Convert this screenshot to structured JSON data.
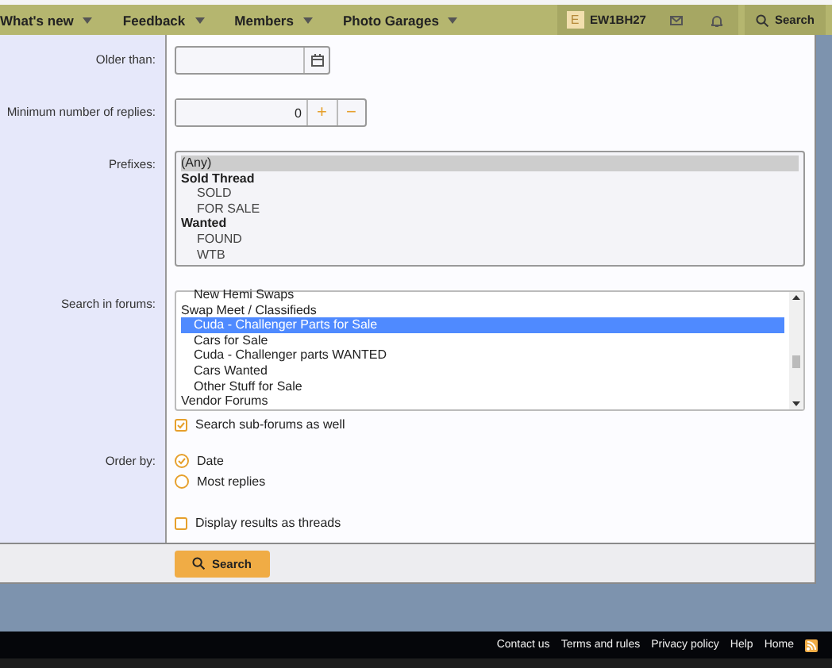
{
  "nav": {
    "items": [
      {
        "label": "What's new"
      },
      {
        "label": "Feedback"
      },
      {
        "label": "Members"
      },
      {
        "label": "Photo Garages"
      }
    ],
    "avatar_letter": "E",
    "username": "EW1BH27",
    "search": "Search"
  },
  "form": {
    "older_than": {
      "label": "Older than:"
    },
    "min_replies": {
      "label": "Minimum number of replies:",
      "value": "0",
      "plus": "+",
      "minus": "−"
    },
    "prefixes": {
      "label": "Prefixes:",
      "items": [
        {
          "label": "(Any)",
          "kind": "option",
          "selected": true
        },
        {
          "label": "Sold Thread",
          "kind": "group",
          "children": [
            {
              "label": "SOLD",
              "kind": "option",
              "selected": false
            },
            {
              "label": "FOR SALE",
              "kind": "option",
              "selected": false
            }
          ]
        },
        {
          "label": "Wanted",
          "kind": "group",
          "children": [
            {
              "label": "FOUND",
              "kind": "option",
              "selected": false
            },
            {
              "label": "WTB",
              "kind": "option",
              "selected": false
            }
          ]
        }
      ]
    },
    "forums": {
      "label": "Search in forums:",
      "items": [
        {
          "label": "New Hemi Swaps",
          "kind": "subforum",
          "selected": false
        },
        {
          "label": "Swap Meet / Classifieds",
          "kind": "category",
          "selected": false,
          "children": [
            {
              "label": "Cuda - Challenger Parts for Sale",
              "kind": "subforum",
              "selected": true
            },
            {
              "label": "Cars for Sale",
              "kind": "subforum",
              "selected": false
            },
            {
              "label": "Cuda - Challenger parts WANTED",
              "kind": "subforum",
              "selected": false
            },
            {
              "label": "Cars Wanted",
              "kind": "subforum",
              "selected": false
            },
            {
              "label": "Other Stuff for Sale",
              "kind": "subforum",
              "selected": false
            }
          ]
        },
        {
          "label": "Vendor Forums",
          "kind": "category",
          "selected": false
        }
      ]
    },
    "subforums": {
      "label": "Search sub-forums as well",
      "checked": true
    },
    "order": {
      "label": "Order by:",
      "options": [
        {
          "label": "Date",
          "selected": true
        },
        {
          "label": "Most replies",
          "selected": false
        }
      ]
    },
    "threads": {
      "label": "Display results as threads",
      "checked": false
    },
    "submit": "Search"
  },
  "footer": {
    "links": [
      "Contact us",
      "Terms and rules",
      "Privacy policy",
      "Help",
      "Home"
    ]
  }
}
